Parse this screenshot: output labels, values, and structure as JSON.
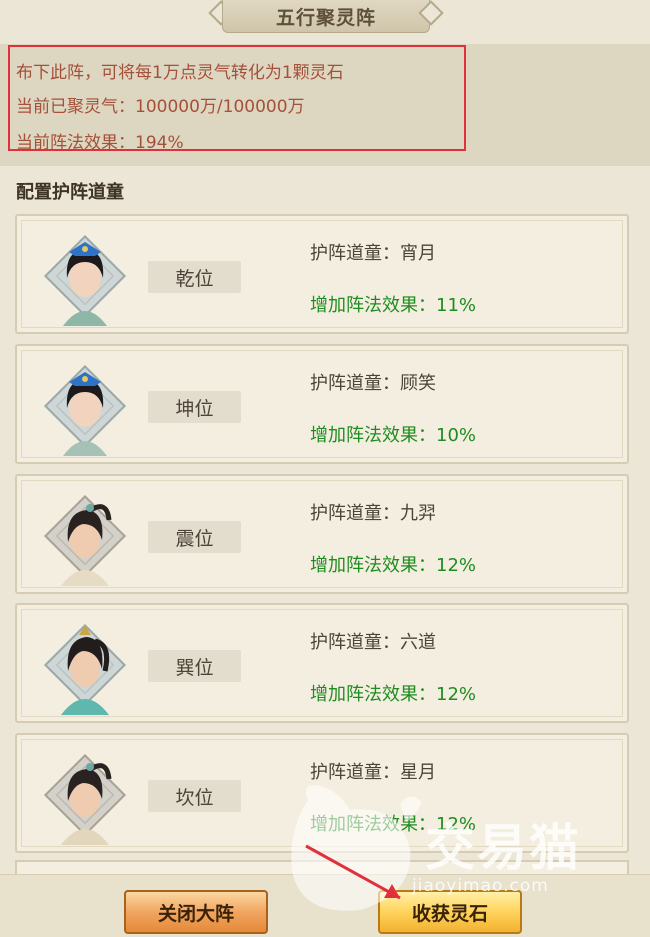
{
  "header": {
    "title": "五行聚灵阵"
  },
  "info": {
    "line1": "布下此阵，可将每1万点灵气转化为1颗灵石",
    "line2": "当前已聚灵气：100000万/100000万",
    "line3": "当前阵法效果：194%"
  },
  "section": {
    "label": "配置护阵道童"
  },
  "slots": [
    {
      "position": "乾位",
      "name_line": "护阵道童：宵月",
      "bonus_line": "增加阵法效果：11%"
    },
    {
      "position": "坤位",
      "name_line": "护阵道童：顾笑",
      "bonus_line": "增加阵法效果：10%"
    },
    {
      "position": "震位",
      "name_line": "护阵道童：九羿",
      "bonus_line": "增加阵法效果：12%"
    },
    {
      "position": "巽位",
      "name_line": "护阵道童：六道",
      "bonus_line": "增加阵法效果：12%"
    },
    {
      "position": "坎位",
      "name_line": "护阵道童：星月",
      "bonus_line": "增加阵法效果：12%"
    }
  ],
  "buttons": {
    "close": "关闭大阵",
    "collect": "收获灵石"
  },
  "watermark": {
    "text": "交易猫",
    "sub": "jiaoyimao.com"
  },
  "colors": {
    "highlight_box": "#e0303c",
    "bonus_text": "#1f8c20",
    "info_text": "#a4513a"
  }
}
